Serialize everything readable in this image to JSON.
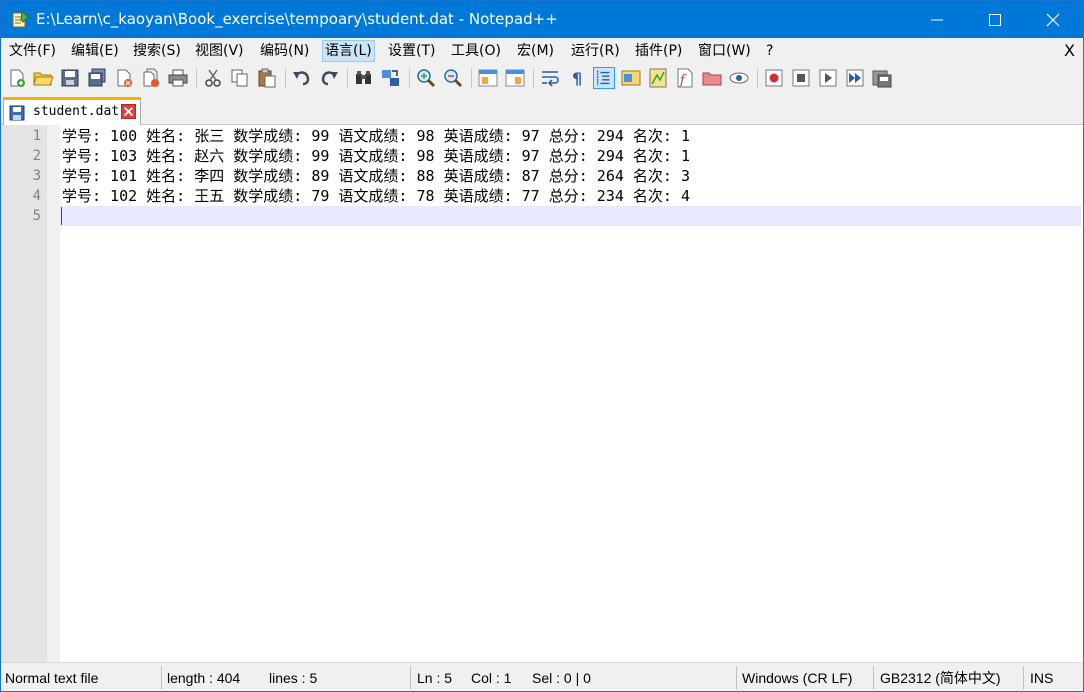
{
  "window": {
    "title": "E:\\Learn\\c_kaoyan\\Book_exercise\\tempoary\\student.dat - Notepad++",
    "icon": "notepad-plus-plus-icon",
    "accent_color": "#0078d7"
  },
  "menu": {
    "items": [
      {
        "label": "文件(F)"
      },
      {
        "label": "编辑(E)"
      },
      {
        "label": "搜索(S)"
      },
      {
        "label": "视图(V)"
      },
      {
        "label": "编码(N)"
      },
      {
        "label": "语言(L)"
      },
      {
        "label": "设置(T)"
      },
      {
        "label": "工具(O)"
      },
      {
        "label": "宏(M)"
      },
      {
        "label": "运行(R)"
      },
      {
        "label": "插件(P)"
      },
      {
        "label": "窗口(W)"
      },
      {
        "label": "?"
      }
    ],
    "close_label": "X"
  },
  "toolbar": {
    "icons": [
      "new-file-icon",
      "open-file-icon",
      "save-icon",
      "save-all-icon",
      "close-icon",
      "close-all-icon",
      "print-icon",
      "cut-icon",
      "copy-icon",
      "paste-icon",
      "undo-icon",
      "redo-icon",
      "find-icon",
      "replace-icon",
      "zoom-in-icon",
      "zoom-out-icon",
      "sync-vertical-icon",
      "sync-horizontal-icon",
      "word-wrap-icon",
      "show-all-characters-icon",
      "indent-guide-icon",
      "user-language-icon",
      "document-map-icon",
      "function-list-icon",
      "folder-as-workspace-icon",
      "monitoring-icon",
      "record-macro-icon",
      "stop-macro-icon",
      "play-macro-icon",
      "run-macro-multiple-icon",
      "save-macro-icon"
    ]
  },
  "tab": {
    "label": "student.dat"
  },
  "editor": {
    "lines": [
      {
        "num": "1",
        "text": "学号: 100 姓名: 张三 数学成绩: 99 语文成绩: 98 英语成绩: 97 总分: 294 名次: 1"
      },
      {
        "num": "2",
        "text": "学号: 103 姓名: 赵六 数学成绩: 99 语文成绩: 98 英语成绩: 97 总分: 294 名次: 1"
      },
      {
        "num": "3",
        "text": "学号: 101 姓名: 李四 数学成绩: 89 语文成绩: 88 英语成绩: 87 总分: 264 名次: 3"
      },
      {
        "num": "4",
        "text": "学号: 102 姓名: 王五 数学成绩: 79 语文成绩: 78 英语成绩: 77 总分: 234 名次: 4"
      },
      {
        "num": "5",
        "text": ""
      }
    ],
    "current_line_color": "#e8e8ff",
    "caret_color": "#8000ff"
  },
  "status": {
    "file_type": "Normal text file",
    "length": "length : 404",
    "lines": "lines : 5",
    "ln": "Ln : 5",
    "col": "Col : 1",
    "sel": "Sel : 0 | 0",
    "eol": "Windows (CR LF)",
    "encoding": "GB2312 (简体中文)",
    "mode": "INS"
  }
}
